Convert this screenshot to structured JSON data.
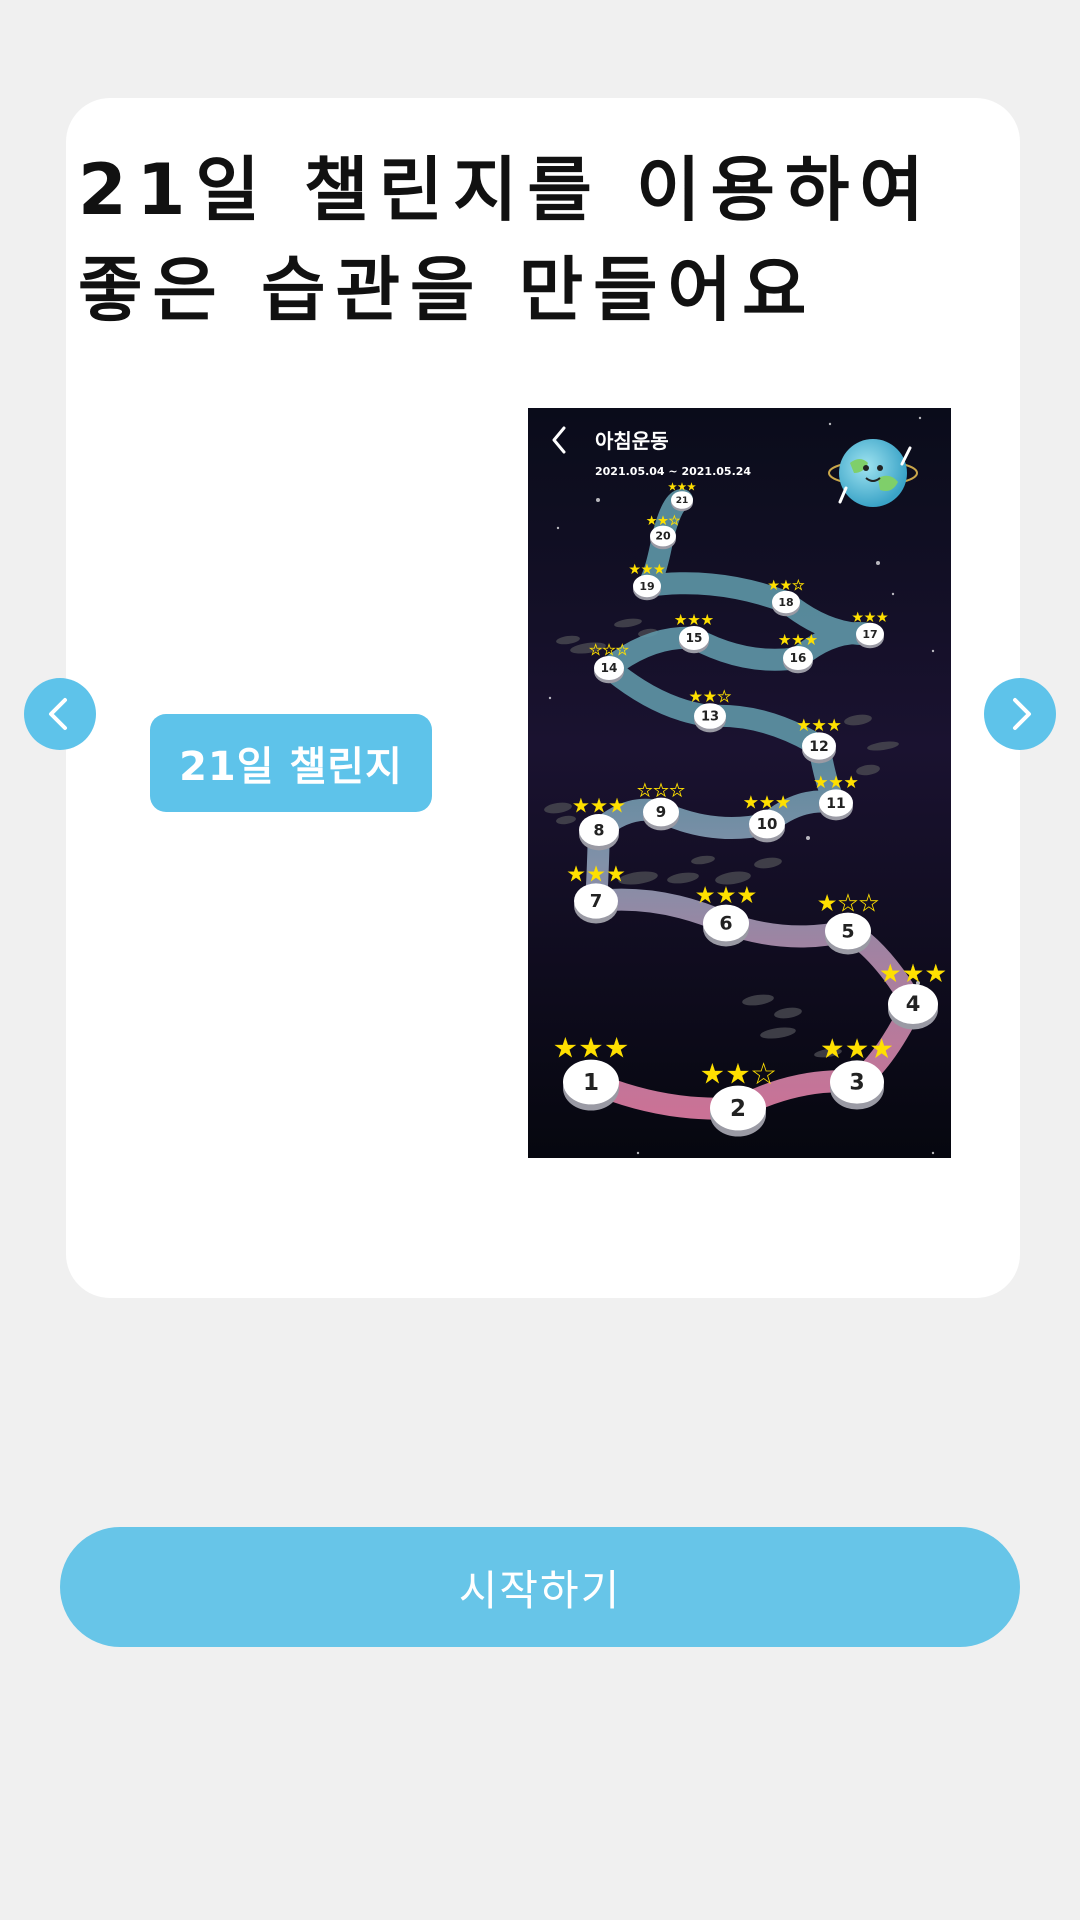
{
  "headline": {
    "line1": "21일 챌린지를 이용하여",
    "line2": "좋은 습관을 만들어요"
  },
  "nav": {
    "prev_icon": "chevron-left-icon",
    "next_icon": "chevron-right-icon"
  },
  "challenge_tag": "21일 챌린지",
  "preview": {
    "title": "아침운동",
    "date_range": "2021.05.04 ~ 2021.05.24",
    "back_icon": "chevron-left-icon",
    "mascot_icon": "earth-planet-icon",
    "stages": [
      {
        "num": "1",
        "stars": 3
      },
      {
        "num": "2",
        "stars": 2
      },
      {
        "num": "3",
        "stars": 3
      },
      {
        "num": "4",
        "stars": 3
      },
      {
        "num": "5",
        "stars": 1
      },
      {
        "num": "6",
        "stars": 3
      },
      {
        "num": "7",
        "stars": 3
      },
      {
        "num": "8",
        "stars": 3
      },
      {
        "num": "9",
        "stars": 0
      },
      {
        "num": "10",
        "stars": 3
      },
      {
        "num": "11",
        "stars": 3
      },
      {
        "num": "12",
        "stars": 3
      },
      {
        "num": "13",
        "stars": 2
      },
      {
        "num": "14",
        "stars": 0
      },
      {
        "num": "15",
        "stars": 3
      },
      {
        "num": "16",
        "stars": 3
      },
      {
        "num": "17",
        "stars": 3
      },
      {
        "num": "18",
        "stars": 2
      },
      {
        "num": "19",
        "stars": 3
      },
      {
        "num": "20",
        "stars": 2
      },
      {
        "num": "21",
        "stars": 3
      }
    ]
  },
  "start_button": "시작하기",
  "colors": {
    "accent": "#5ec3ea",
    "button": "#67c5e8",
    "background": "#f0f0f0",
    "star": "#ffe000"
  }
}
